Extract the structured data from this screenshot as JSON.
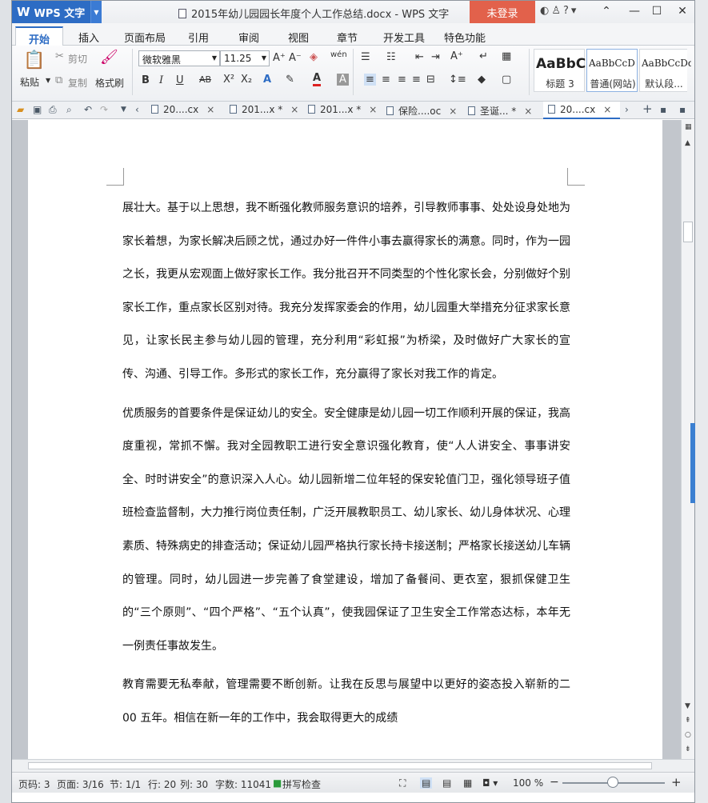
{
  "app": {
    "name": "WPS 文字",
    "logo": "W"
  },
  "window": {
    "title": "2015年幼儿园园长年度个人工作总结.docx - WPS 文字",
    "login_label": "未登录"
  },
  "menu_tabs": [
    "开始",
    "插入",
    "页面布局",
    "引用",
    "审阅",
    "视图",
    "章节",
    "开发工具",
    "特色功能"
  ],
  "active_tab": "开始",
  "ribbon": {
    "paste_label": "粘贴",
    "cut_label": "剪切",
    "copy_label": "复制",
    "format_painter_label": "格式刷",
    "font_name": "微软雅黑",
    "font_size": "11.25",
    "styles": [
      {
        "preview": "AaBbC",
        "label": "标题 3"
      },
      {
        "preview": "AaBbCcD",
        "label": "普通(网站)"
      },
      {
        "preview": "AaBbCcDd",
        "label": "默认段..."
      }
    ]
  },
  "doc_tabs": [
    {
      "label": "20....cx",
      "close": "×"
    },
    {
      "label": "201...x *",
      "close": "×"
    },
    {
      "label": "201...x *",
      "close": "×"
    },
    {
      "label": "保险....oc",
      "close": "×"
    },
    {
      "label": "圣诞... *",
      "close": "×"
    },
    {
      "label": "20....cx",
      "close": "×"
    }
  ],
  "document": {
    "paragraphs": [
      "展壮大。基于以上思想，我不断强化教师服务意识的培养，引导教师事事、处处设身处地为家长着想，为家长解决后顾之忧，通过办好一件件小事去赢得家长的满意。同时，作为一园之长，我更从宏观面上做好家长工作。我分批召开不同类型的个性化家长会，分别做好个别家长工作，重点家长区别对待。我充分发挥家委会的作用，幼儿园重大举措充分征求家长意见，让家长民主参与幼儿园的管理，充分利用“彩虹报”为桥梁，及时做好广大家长的宣传、沟通、引导工作。多形式的家长工作，充分赢得了家长对我工作的肯定。",
      "优质服务的首要条件是保证幼儿的安全。安全健康是幼儿园一切工作顺利开展的保证，我高度重视，常抓不懈。我对全园教职工进行安全意识强化教育，使“人人讲安全、事事讲安全、时时讲安全”的意识深入人心。幼儿园新增二位年轻的保安轮值门卫，强化领导班子值班检查监督制，大力推行岗位责任制，广泛开展教职员工、幼儿家长、幼儿身体状况、心理素质、特殊病史的排查活动；保证幼儿园严格执行家长持卡接送制；严格家长接送幼儿车辆的管理。同时，幼儿园进一步完善了食堂建设，增加了备餐间、更衣室，狠抓保健卫生的“三个原则”、“四个严格”、“五个认真”，使我园保证了卫生安全工作常态达标，本年无一例责任事故发生。",
      "教育需要无私奉献，管理需要不断创新。让我在反思与展望中以更好的姿态投入崭新的二 00 五年。相信在新一年的工作中，我会取得更大的成绩"
    ]
  },
  "status": {
    "page_num": "页码: 3",
    "pages": "页面: 3/16",
    "section": "节: 1/1",
    "row": "行: 20",
    "col": "列: 30",
    "word_count": "字数: 11041",
    "spell_check": "拼写检查",
    "zoom": "100 %"
  },
  "colors": {
    "brand": "#2d6cc4",
    "login": "#e2614b"
  }
}
